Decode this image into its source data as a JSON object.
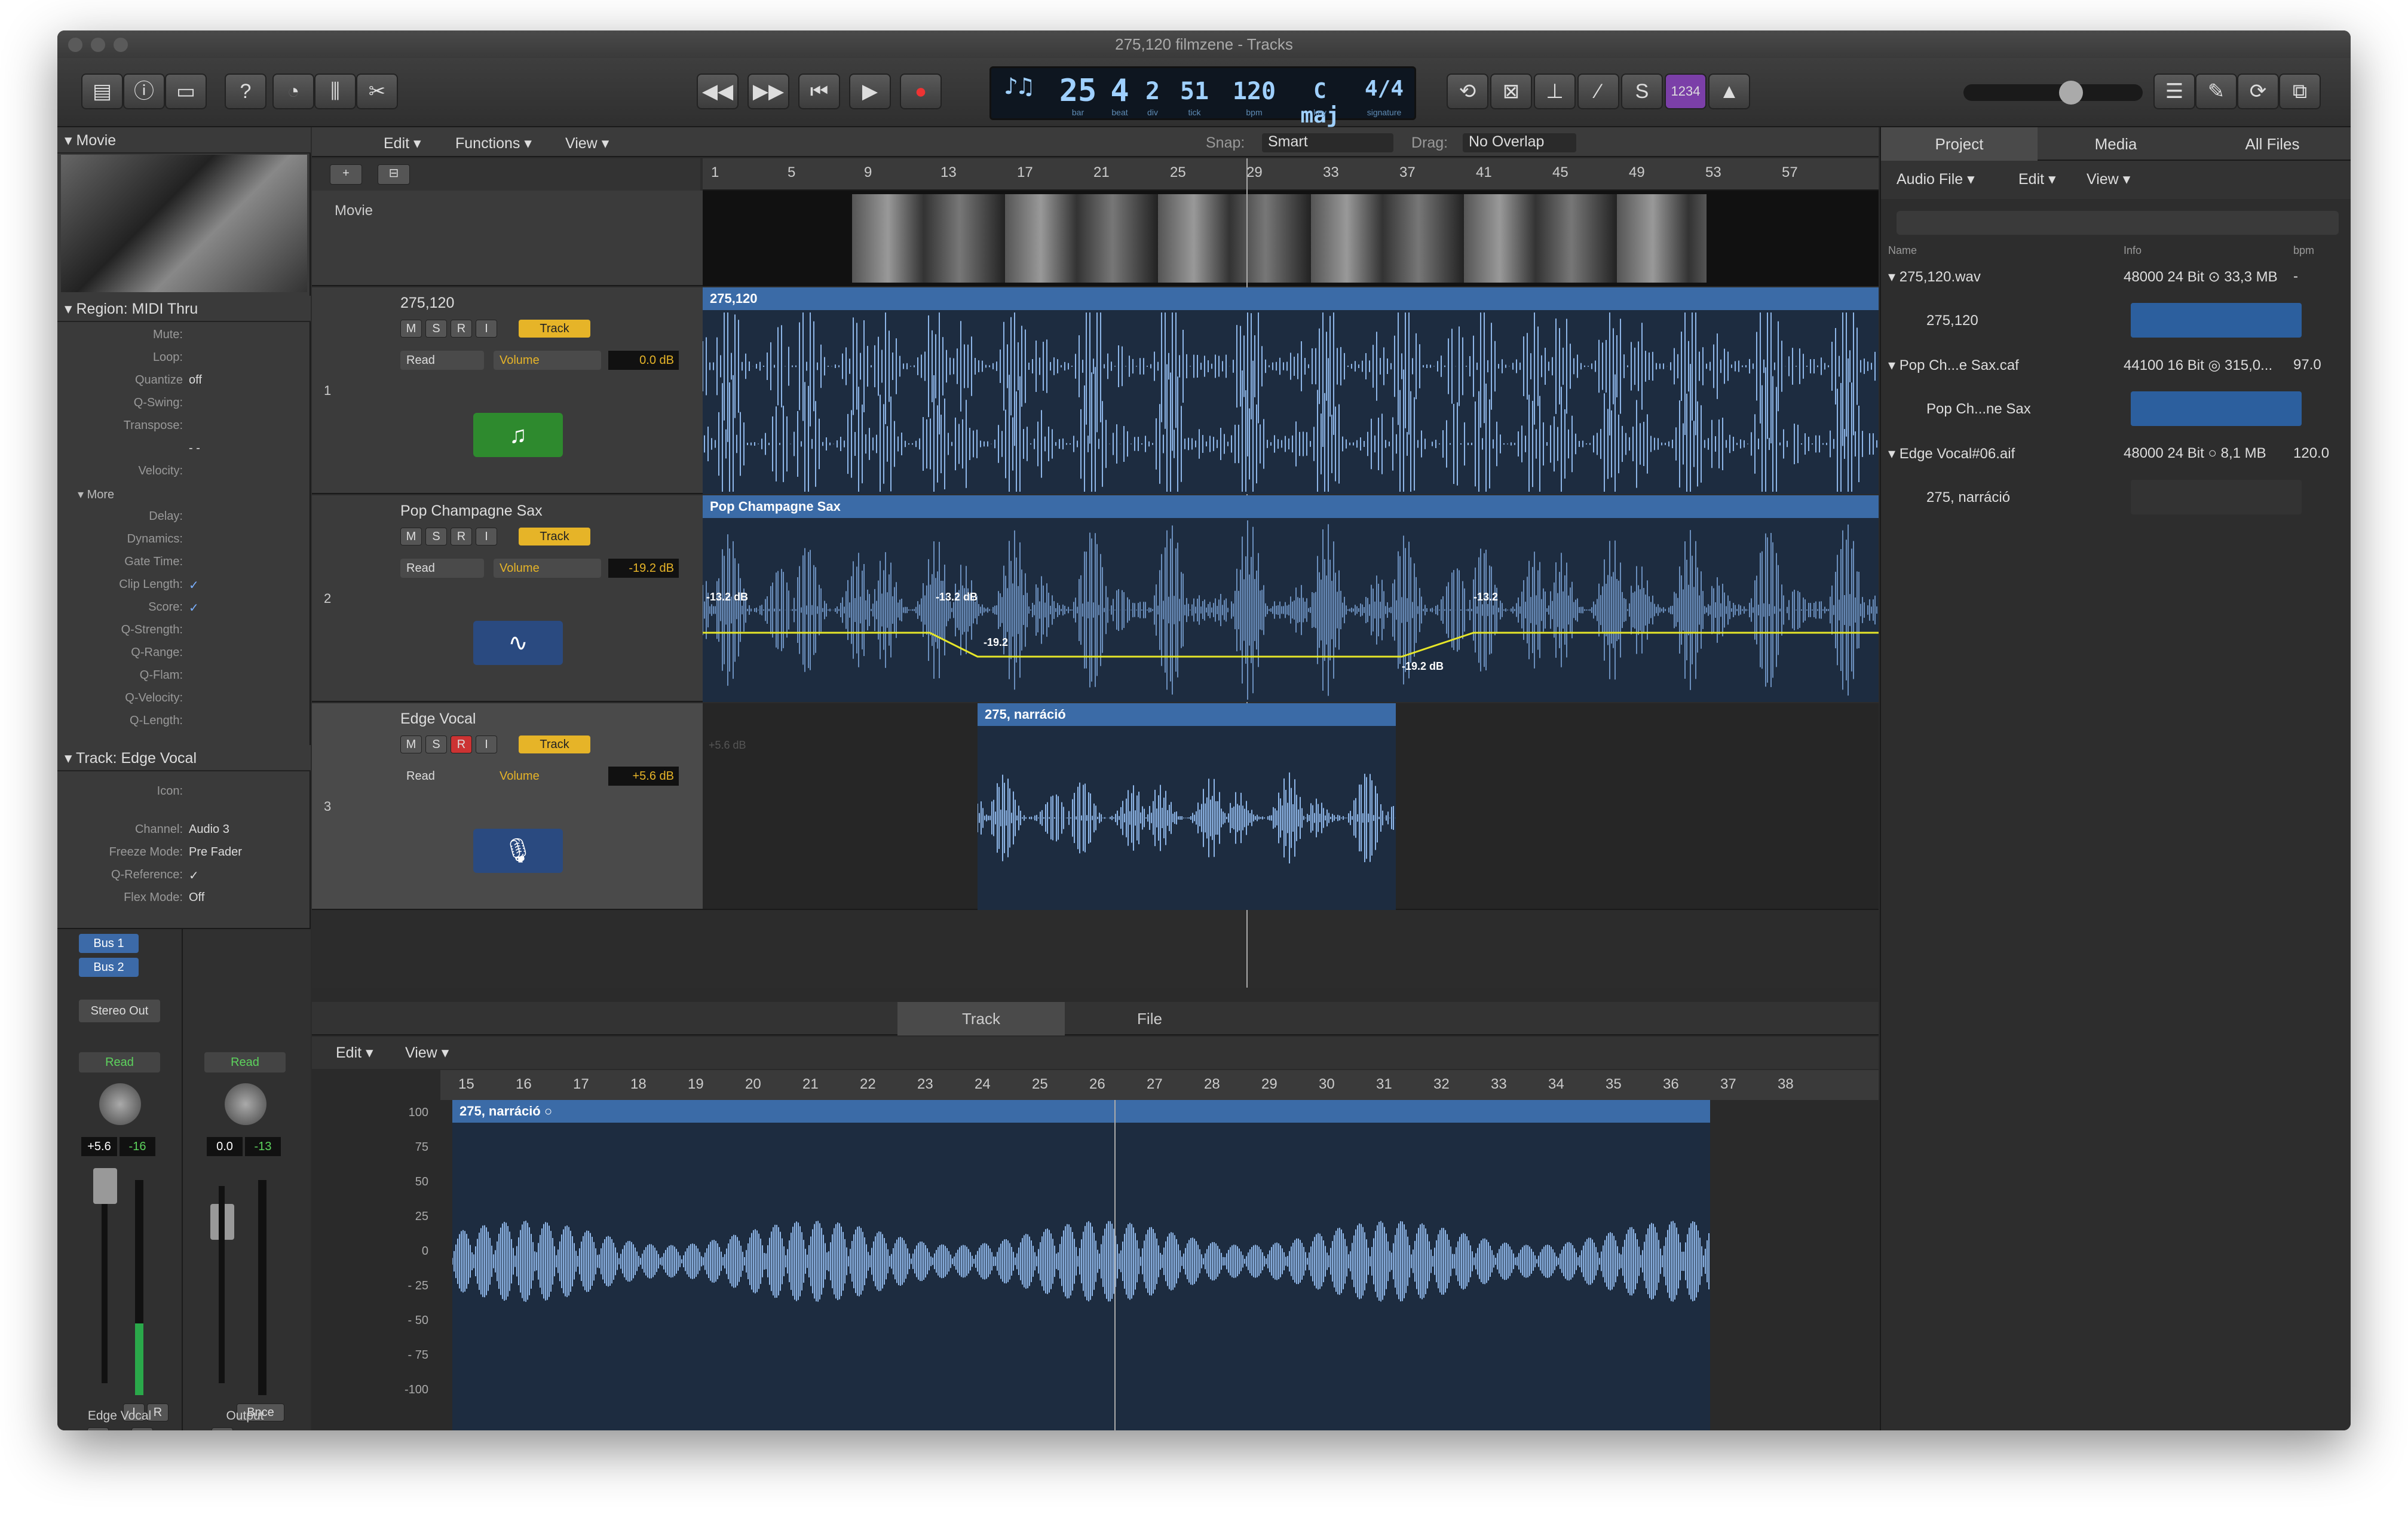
{
  "window": {
    "title": "275,120 filmzene - Tracks"
  },
  "lcd": {
    "bar": "25",
    "beat": "4",
    "div": "2",
    "tick": "51",
    "bpm": "120",
    "key": "C maj",
    "sig": "4/4",
    "bar_l": "bar",
    "beat_l": "beat",
    "div_l": "div",
    "tick_l": "tick",
    "bpm_l": "bpm",
    "key_l": "key",
    "sig_l": "signature",
    "counter": "1234"
  },
  "toolbar": {
    "icons": [
      "library-icon",
      "info-icon",
      "editor-icon",
      "help-icon",
      "smart-controls-icon",
      "mixer-icon",
      "editors-icon",
      "rewind-icon",
      "forward-icon",
      "to-start-icon",
      "play-icon",
      "record-icon",
      "cycle-icon",
      "replace-icon",
      "autopunch-icon",
      "tuner-icon",
      "solo-icon",
      "count-in-icon",
      "metronome-icon",
      "list-icon",
      "notepad-icon",
      "loop-browser-icon",
      "browser-icon"
    ]
  },
  "inspector": {
    "movie_label": "Movie",
    "region_title": "Region: MIDI Thru",
    "region_rows": [
      {
        "l": "Mute:",
        "v": ""
      },
      {
        "l": "Loop:",
        "v": ""
      },
      {
        "l": "Quantize",
        "v": "off"
      },
      {
        "l": "Q-Swing:",
        "v": ""
      },
      {
        "l": "Transpose:",
        "v": ""
      },
      {
        "l": "",
        "v": "- -"
      },
      {
        "l": "Velocity:",
        "v": ""
      }
    ],
    "more_label": "More",
    "more_rows": [
      {
        "l": "Delay:",
        "v": ""
      },
      {
        "l": "Dynamics:",
        "v": ""
      },
      {
        "l": "Gate Time:",
        "v": ""
      },
      {
        "l": "Clip Length:",
        "v": "✓"
      },
      {
        "l": "Score:",
        "v": "✓"
      },
      {
        "l": "Q-Strength:",
        "v": ""
      },
      {
        "l": "Q-Range:",
        "v": ""
      },
      {
        "l": "Q-Flam:",
        "v": ""
      },
      {
        "l": "Q-Velocity:",
        "v": ""
      },
      {
        "l": "Q-Length:",
        "v": ""
      }
    ],
    "track_title": "Track:  Edge Vocal",
    "track_rows": [
      {
        "l": "Icon:",
        "v": ""
      },
      {
        "l": "Channel:",
        "v": "Audio 3"
      },
      {
        "l": "Freeze Mode:",
        "v": "Pre Fader"
      },
      {
        "l": "Q-Reference:",
        "v": "✓"
      },
      {
        "l": "Flex Mode:",
        "v": "Off"
      }
    ],
    "bus1": "Bus 1",
    "bus2": "Bus 2",
    "stereo_out": "Stereo Out",
    "ch1": {
      "auto": "Read",
      "vol": "+5.6",
      "peak": "-16",
      "name": "Edge Vocal",
      "ir": "I",
      "r": "R",
      "m": "M",
      "s": "S"
    },
    "ch2": {
      "auto": "Read",
      "vol": "0.0",
      "peak": "-13",
      "name": "Output",
      "bnce": "Bnce",
      "m": "M"
    }
  },
  "tracks_menu": {
    "edit": "Edit",
    "functions": "Functions",
    "view": "View",
    "snap_label": "Snap:",
    "snap": "Smart",
    "drag_label": "Drag:",
    "drag": "No Overlap"
  },
  "ruler": [
    "1",
    "5",
    "9",
    "13",
    "17",
    "21",
    "25",
    "29",
    "33",
    "37",
    "41",
    "45",
    "49",
    "53",
    "57"
  ],
  "movie_track": {
    "label": "Movie"
  },
  "tracks": [
    {
      "num": "1",
      "name": "275,120",
      "auto": "Read",
      "param": "Volume",
      "val": "0.0 dB",
      "region": "275,120",
      "m": "M",
      "s": "S",
      "r": "R",
      "i": "I",
      "track": "Track"
    },
    {
      "num": "2",
      "name": "Pop Champagne Sax",
      "auto": "Read",
      "param": "Volume",
      "val": "-19.2 dB",
      "region": "Pop Champagne Sax",
      "m": "M",
      "s": "S",
      "r": "R",
      "i": "I",
      "track": "Track",
      "auto_pts": [
        "-13.2 dB",
        "-13.2 dB",
        "-19.2",
        "-19.2 dB",
        "-13.2"
      ]
    },
    {
      "num": "3",
      "name": "Edge Vocal",
      "auto": "Read",
      "param": "Volume",
      "val": "+5.6 dB",
      "region": "275, narráció",
      "m": "M",
      "s": "S",
      "r": "R",
      "i": "I",
      "track": "Track",
      "ghost": "+5.6 dB"
    }
  ],
  "editor": {
    "tab_track": "Track",
    "tab_file": "File",
    "edit": "Edit",
    "view": "View",
    "region": "275, narráció",
    "ruler": [
      "15",
      "16",
      "17",
      "18",
      "19",
      "20",
      "21",
      "22",
      "23",
      "24",
      "25",
      "26",
      "27",
      "28",
      "29",
      "30",
      "31",
      "32",
      "33",
      "34",
      "35",
      "36",
      "37",
      "38"
    ],
    "yaxis": [
      "100",
      "75",
      "50",
      "25",
      "0",
      "- 25",
      "- 50",
      "- 75",
      "-100"
    ]
  },
  "browser": {
    "tabs": [
      "Project",
      "Media",
      "All Files"
    ],
    "audio_file": "Audio File",
    "edit": "Edit",
    "view": "View",
    "col_name": "Name",
    "col_info": "Info",
    "col_bpm": "bpm",
    "files": [
      {
        "name": "275,120.wav",
        "info": "48000 24 Bit ⊙ 33,3 MB",
        "bpm": "-",
        "region": "275,120"
      },
      {
        "name": "Pop Ch...e Sax.caf",
        "info": "44100 16 Bit ◎ 315,0...",
        "bpm": "97.0",
        "region": "Pop Ch...ne Sax"
      },
      {
        "name": "Edge Vocal#06.aif",
        "info": "48000 24 Bit ○ 8,1 MB",
        "bpm": "120.0",
        "region": "275, narráció"
      }
    ]
  }
}
